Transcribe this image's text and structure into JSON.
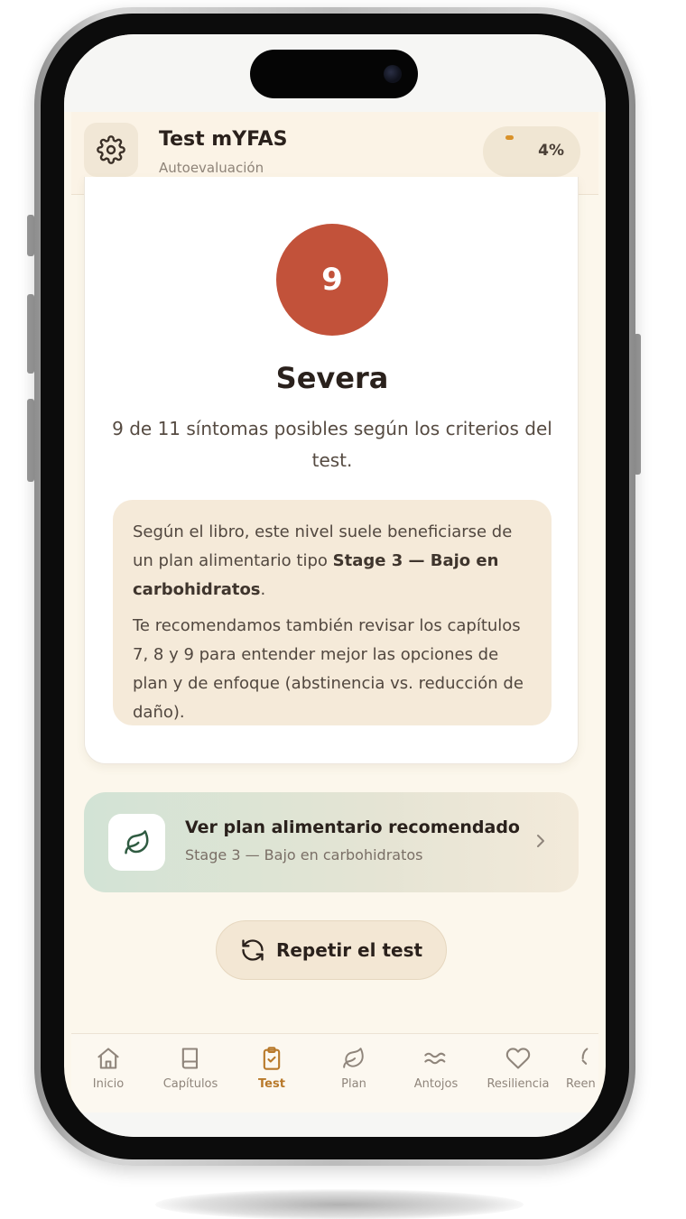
{
  "header": {
    "title": "Test mYFAS",
    "subtitle": "Autoevaluación",
    "progress_label": "4%",
    "progress_value": 0.04
  },
  "result": {
    "score": "9",
    "severity": "Severa",
    "symptoms_text": "9 de 11 síntomas posibles según los criterios del test.",
    "score_color": "#c2523a"
  },
  "info": {
    "p1_before": "Según el libro, este nivel suele beneficiarse de un plan alimentario tipo ",
    "p1_bold": "Stage 3 — Bajo en carbohidratos",
    "p1_after": ".",
    "p2": "Te recomendamos también revisar los capítulos 7, 8 y 9 para entender mejor las opciones de plan y de enfoque (abstinencia vs. reducción de daño)."
  },
  "plan_card": {
    "title": "Ver plan alimentario recomendado",
    "subtitle": "Stage 3 — Bajo en carbohidratos",
    "icon": "leaf-icon"
  },
  "repeat": {
    "label": "Repetir el test",
    "icon": "refresh-icon"
  },
  "tabs": [
    {
      "label": "Inicio",
      "icon": "home-icon"
    },
    {
      "label": "Capítulos",
      "icon": "book-icon"
    },
    {
      "label": "Test",
      "icon": "clipboard-check-icon",
      "active": true
    },
    {
      "label": "Plan",
      "icon": "leaf-icon"
    },
    {
      "label": "Antojos",
      "icon": "waves-icon"
    },
    {
      "label": "Resiliencia",
      "icon": "heart-icon"
    },
    {
      "label": "Reen",
      "icon": "partial-icon"
    }
  ],
  "colors": {
    "accent": "#b8792a",
    "background": "#fcf7ec"
  }
}
